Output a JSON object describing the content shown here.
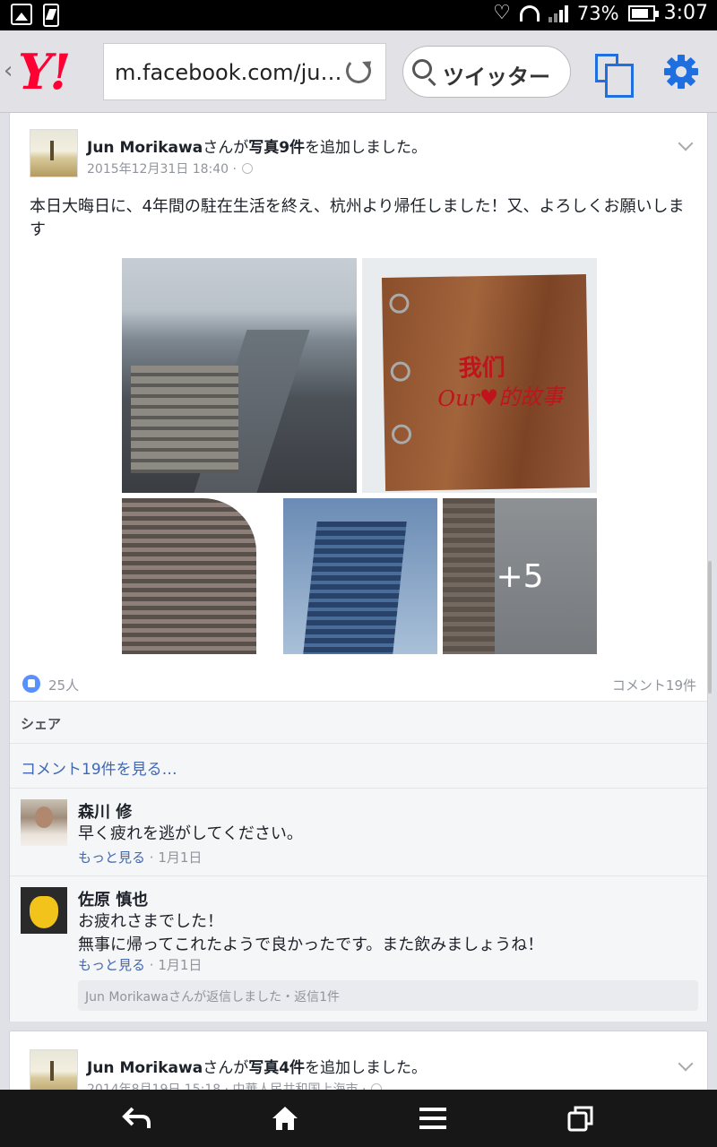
{
  "status_bar": {
    "battery": "73%",
    "time": "3:07"
  },
  "browser": {
    "logo": "Y!",
    "url": "m.facebook.com/ju…",
    "search_query": "ツイッター",
    "accent_color": "#1f6fe0"
  },
  "post1": {
    "author": "Jun Morikawa",
    "action_pre": "さんが",
    "photos_label": "写真9件",
    "action_post": "を追加しました。",
    "date": "2015年12月31日 18:40 ·",
    "text": "本日大晦日に、4年間の駐在生活を終え、杭州より帰任しました！又、よろしくお願いします",
    "photo_book_line1": "我们",
    "photo_book_line2": "Our♥的故事",
    "more_photos": "+5",
    "likes": "25人",
    "comment_count": "コメント19件",
    "share_label": "シェア",
    "view_comments": "コメント19件を見る…"
  },
  "comments": [
    {
      "name": "森川 修",
      "text": "早く疲れを逃がしてください。",
      "more": "もっと見る",
      "date": " · 1月1日"
    },
    {
      "name": "佐原 慎也",
      "text_line1": "お疲れさまでした！",
      "text_line2": "無事に帰ってこれたようで良かったです。また飲みましょうね！",
      "more": "もっと見る",
      "date": " · 1月1日",
      "reply": "Jun Morikawaさんが返信しました・返信1件"
    }
  ],
  "post2": {
    "author": "Jun Morikawa",
    "action_pre": "さんが",
    "photos_label": "写真4件",
    "action_post": "を追加しました。",
    "date": "2014年8月19日 15:18 · 中華人民共和国上海市 ·"
  },
  "navbar": [
    "back-icon",
    "home-icon",
    "menu-icon",
    "recent-apps-icon"
  ]
}
